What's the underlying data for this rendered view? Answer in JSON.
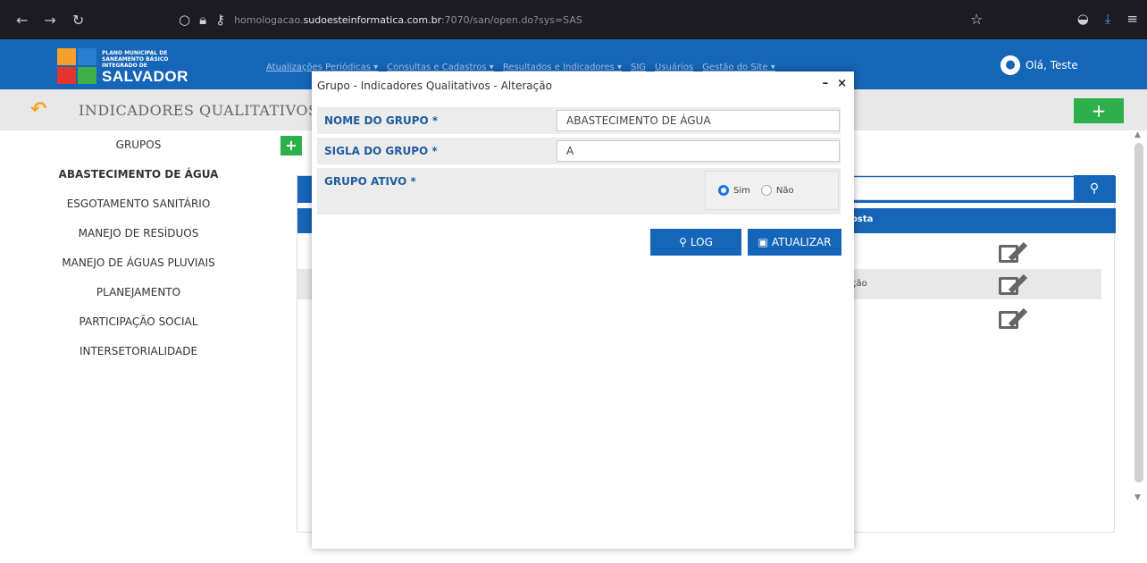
{
  "browser": {
    "url_host": "homologacao.",
    "url_domain": "sudoesteinformatica.com.br",
    "url_rest": ":7070/san/open.do?sys=SAS"
  },
  "header": {
    "logo_small_1": "PLANO MUNICIPAL DE",
    "logo_small_2": "SANEAMENTO BÁSICO",
    "logo_small_3": "INTEGRADO DE",
    "logo_big": "SALVADOR",
    "menu": [
      "Atualizações Periódicas ▾",
      "Consultas e Cadastros ▾",
      "Resultados e Indicadores ▾",
      "SIG",
      "Usuários",
      "Gestão do Site ▾"
    ],
    "user_greeting": "Olá, Teste"
  },
  "page": {
    "title": "INDICADORES QUALITATIVOS",
    "add_label": "+"
  },
  "sidebar": {
    "items": [
      "GRUPOS",
      "ABASTECIMENTO DE ÁGUA",
      "ESGOTAMENTO SANITÁRIO",
      "MANEJO DE RESÍDUOS",
      "MANEJO DE ÁGUAS PLUVIAIS",
      "PLANEJAMENTO",
      "PARTICIPAÇÃO SOCIAL",
      "INTERSETORIALIDADE"
    ],
    "add_label": "+"
  },
  "table": {
    "header_partial": "osta",
    "row_partial": "ção"
  },
  "modal": {
    "title": "Grupo - Indicadores Qualitativos - Alteração",
    "minimize": "–",
    "close": "×",
    "fields": {
      "nome_label": "NOME DO GRUPO *",
      "nome_value": "ABASTECIMENTO DE ÁGUA",
      "sigla_label": "SIGLA DO GRUPO *",
      "sigla_value": "A",
      "ativo_label": "GRUPO ATIVO *",
      "sim_label": "Sim",
      "nao_label": "Não",
      "ativo_selected": "Sim"
    },
    "buttons": {
      "log": "LOG",
      "atualizar": "ATUALIZAR"
    }
  },
  "colors": {
    "primary": "#1565b8",
    "success": "#2db04a",
    "accent": "#f5a623"
  }
}
